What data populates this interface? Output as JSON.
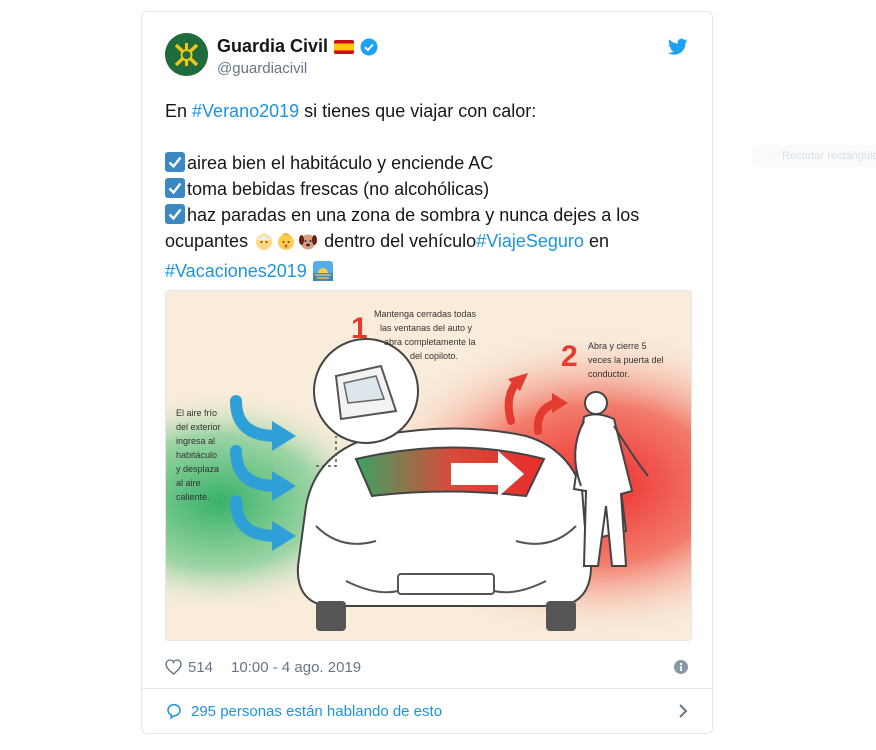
{
  "account": {
    "name": "Guardia Civil",
    "flag": "🇪🇸",
    "handle": "@guardiacivil"
  },
  "tweet": {
    "intro_prefix": "En ",
    "intro_hashtag": "#Verano2019",
    "intro_suffix": " si tienes que viajar con calor:",
    "item1": "airea bien el habitáculo y enciende AC",
    "item2": "toma bebidas frescas (no alcohólicas)",
    "item3_a": "haz paradas en una zona de sombra y nunca dejes a los ocupantes ",
    "item3_b": " dentro del vehículo",
    "hashtag_viaje": "#ViajeSeguro",
    "word_en": " en",
    "hashtag_vacaciones": "#Vacaciones2019"
  },
  "infographic": {
    "num1": "1",
    "step1": [
      "Mantenga cerradas todas",
      "las ventanas del auto y",
      "abra completamente la",
      "del copiloto."
    ],
    "num2": "2",
    "step2": [
      "Abra y cierre 5",
      "veces la puerta del",
      "conductor."
    ],
    "left_note": [
      "El aire frío",
      "del exterior",
      "ingresa al",
      "habitáculo",
      "y desplaza",
      "al aire",
      "caliente."
    ]
  },
  "meta": {
    "likes": "514",
    "timestamp": "10:00 - 4 ago. 2019"
  },
  "talking": {
    "label": "295 personas están hablando de esto"
  },
  "side_ghost": "Recortar rectángulo",
  "colors": {
    "link": "#1b95e0",
    "muted": "#657786",
    "verified": "#1da1f2",
    "check_emoji": "#3b88c3",
    "border": "#e1e8ed"
  },
  "icons": [
    "twitter-bird-icon",
    "verified-badge-icon",
    "check-box-icon",
    "heart-icon",
    "info-icon",
    "comment-icon",
    "chevron-right-icon"
  ]
}
